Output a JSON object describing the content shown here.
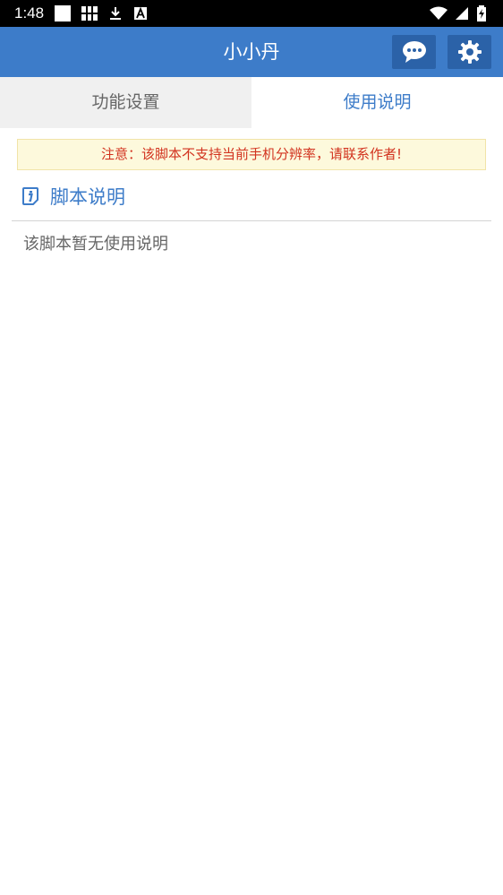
{
  "status_bar": {
    "time": "1:48"
  },
  "app_bar": {
    "title": "小小丹",
    "chat_icon": "chat-bubble-icon",
    "settings_icon": "gear-icon"
  },
  "tabs": [
    {
      "label": "功能设置",
      "active": false
    },
    {
      "label": "使用说明",
      "active": true
    }
  ],
  "notice": {
    "text": "注意：该脚本不支持当前手机分辨率，请联系作者!"
  },
  "section": {
    "icon": "info-icon",
    "title": "脚本说明",
    "body": "该脚本暂无使用说明"
  },
  "colors": {
    "primary": "#3d7cc9",
    "button_dark": "#2b62a8",
    "notice_bg": "#fdf9dc",
    "notice_text": "#d2331f"
  }
}
